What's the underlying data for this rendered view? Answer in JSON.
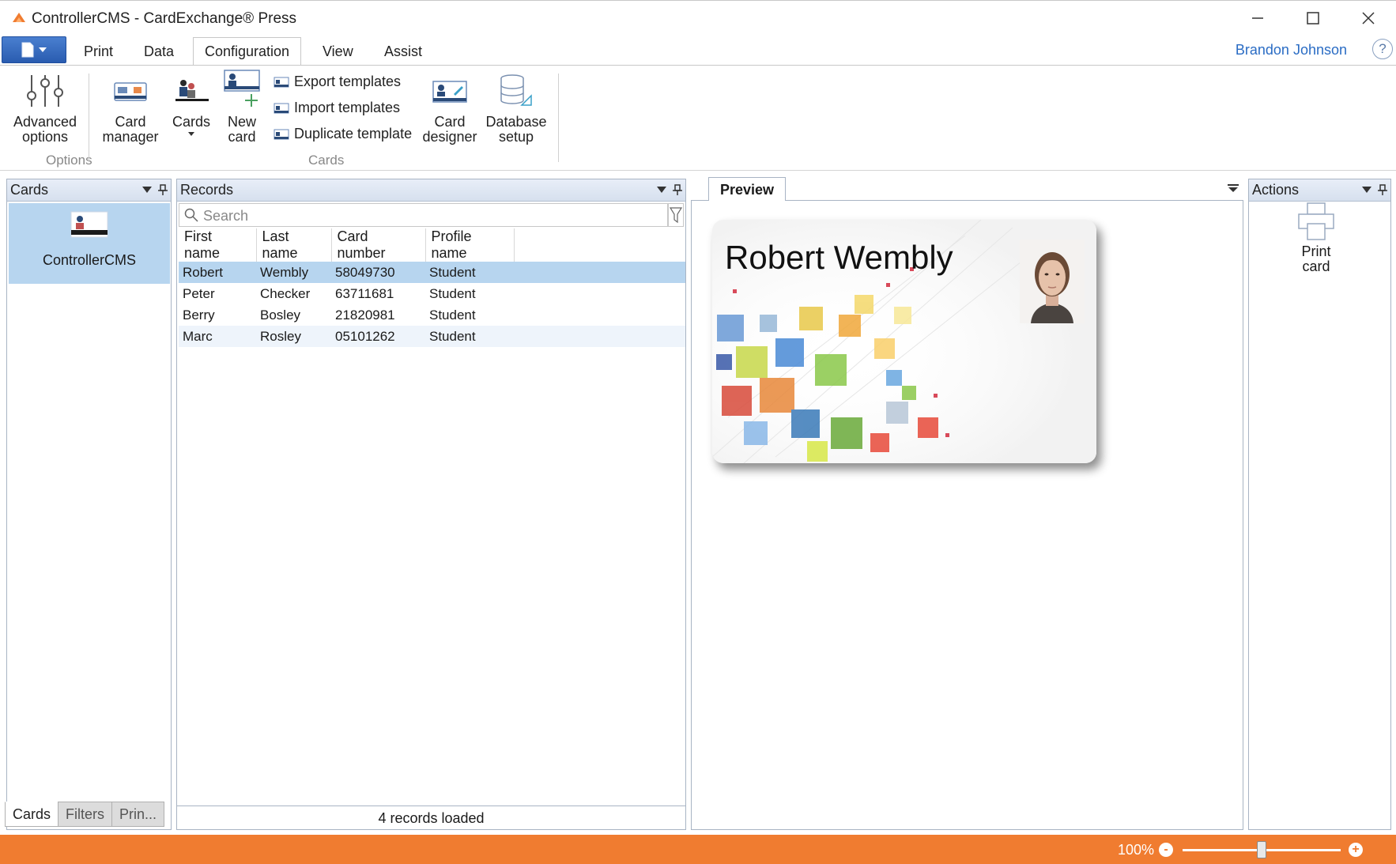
{
  "window": {
    "title": "ControllerCMS - CardExchange® Press",
    "app_icon": "cardexchange-logo-icon"
  },
  "ribbon_tabs": [
    "Print",
    "Data",
    "Configuration",
    "View",
    "Assist"
  ],
  "active_tab": "Configuration",
  "user": {
    "name": "Brandon Johnson",
    "help": "?"
  },
  "ribbon": {
    "options_group": {
      "label": "Options",
      "advanced_options": [
        "Advanced",
        "options"
      ]
    },
    "cards_group": {
      "label": "Cards",
      "card_manager": [
        "Card",
        "manager"
      ],
      "cards": "Cards",
      "new_card": [
        "New",
        "card"
      ],
      "export_templates": "Export templates",
      "import_templates": "Import templates",
      "duplicate_template": "Duplicate template",
      "card_designer": [
        "Card",
        "designer"
      ],
      "database_setup": [
        "Database",
        "setup"
      ]
    }
  },
  "cards_panel": {
    "title": "Cards",
    "items": [
      {
        "label": "ControllerCMS"
      }
    ],
    "bottom_tabs": [
      "Cards",
      "Filters",
      "Prin..."
    ]
  },
  "records_panel": {
    "title": "Records",
    "search_placeholder": "Search",
    "columns": [
      "First name",
      "Last name",
      "Card number",
      "Profile name"
    ],
    "rows": [
      [
        "Robert",
        "Wembly",
        "58049730",
        "Student"
      ],
      [
        "Peter",
        "Checker",
        "63711681",
        "Student"
      ],
      [
        "Berry",
        "Bosley",
        "21820981",
        "Student"
      ],
      [
        "Marc",
        "Rosley",
        "05101262",
        "Student"
      ]
    ],
    "footer": "4 records loaded"
  },
  "preview": {
    "tab_label": "Preview",
    "card_name": "Robert Wembly"
  },
  "actions_panel": {
    "title": "Actions",
    "print_card": [
      "Print",
      "card"
    ]
  },
  "status": {
    "zoom": "100%",
    "zoom_minus": "-",
    "zoom_plus": "+"
  },
  "colors": {
    "accent_orange": "#f07c30",
    "selection_blue": "#b7d5ef",
    "link_blue": "#2a6cc4"
  }
}
